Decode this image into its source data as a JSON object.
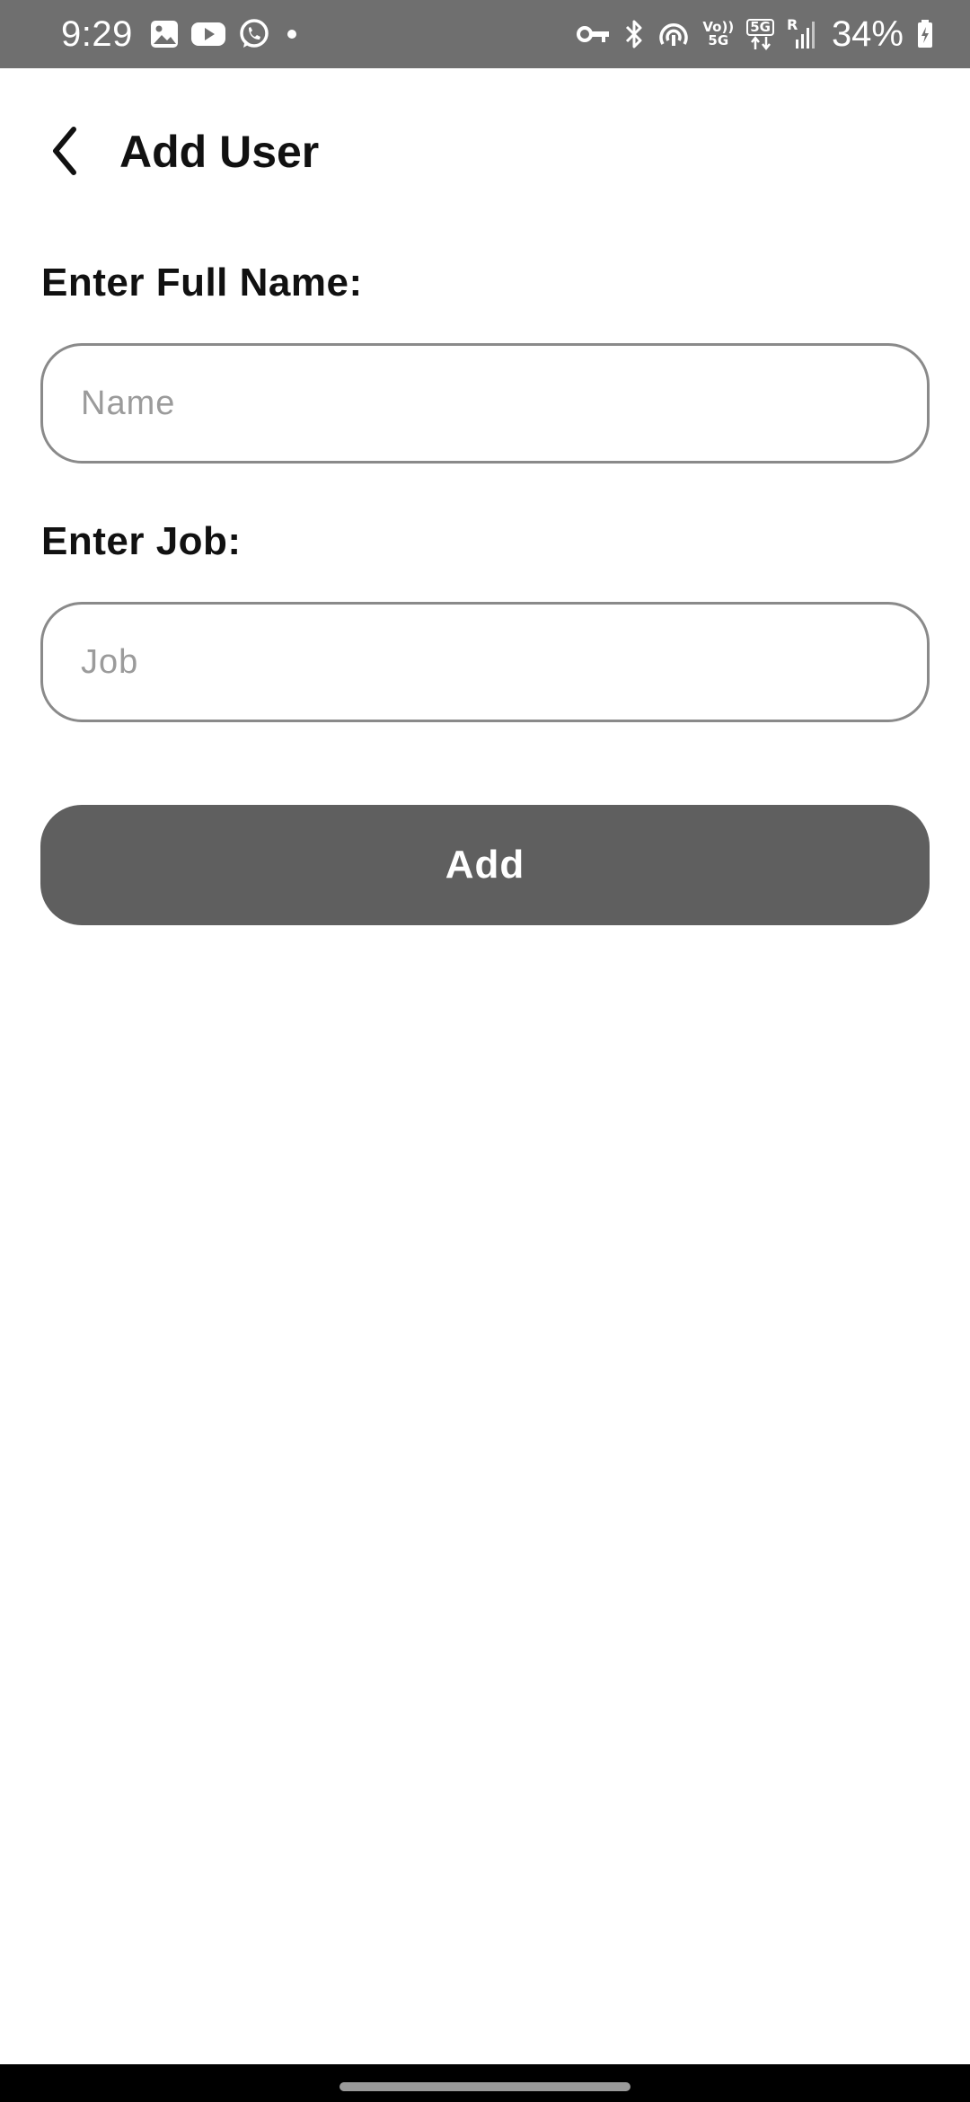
{
  "status_bar": {
    "time": "9:29",
    "battery_percent": "34%",
    "left_icons": [
      "gallery-icon",
      "youtube-icon",
      "whatsapp-icon",
      "dot-icon"
    ],
    "right_icons": [
      "vpn-key-icon",
      "bluetooth-icon",
      "hotspot-icon",
      "volte-icon",
      "5g-data-icon",
      "signal-icon",
      "battery-charging-icon"
    ],
    "volte_top": "Vo))",
    "volte_bottom": "5G",
    "network_label": "5G",
    "roaming_label": "R"
  },
  "app_bar": {
    "back_icon": "chevron-left-icon",
    "title": "Add User"
  },
  "form": {
    "name_label": "Enter Full Name:",
    "name_placeholder": "Name",
    "name_value": "",
    "job_label": "Enter Job:",
    "job_placeholder": "Job",
    "job_value": "",
    "add_button_label": "Add"
  },
  "colors": {
    "status_bar_bg": "#6f6f6f",
    "button_bg": "#5f5f5f",
    "input_border": "#8a8a8a",
    "nav_bar_bg": "#000000"
  }
}
